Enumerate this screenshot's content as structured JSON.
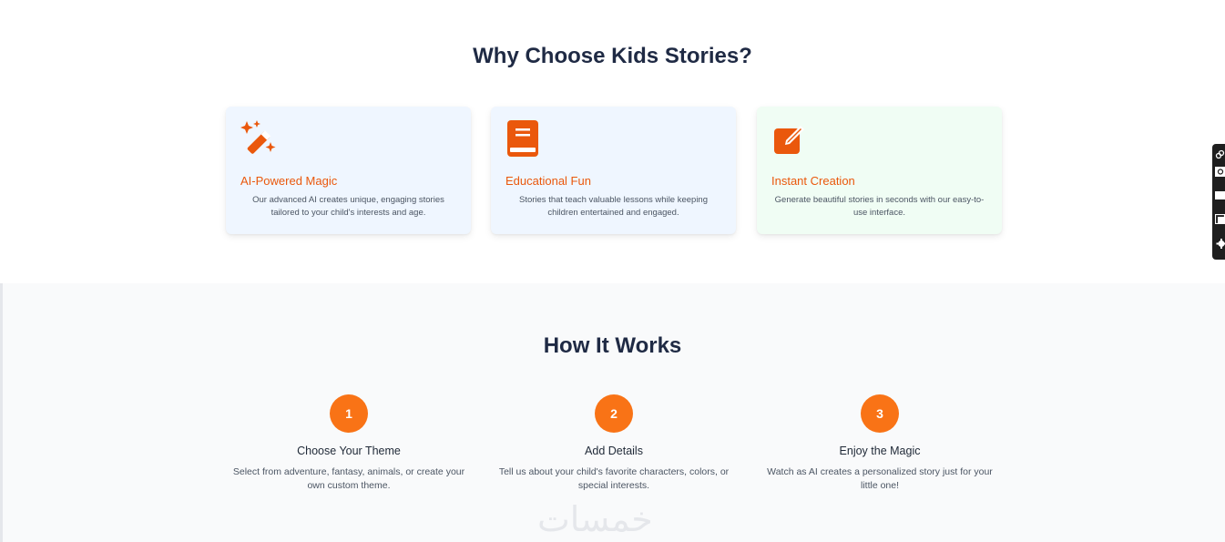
{
  "why": {
    "title": "Why Choose Kids Stories?",
    "cards": [
      {
        "icon": "magic-wand-icon",
        "title": "AI-Powered Magic",
        "description": "Our advanced AI creates unique, engaging stories tailored to your child's interests and age."
      },
      {
        "icon": "book-icon",
        "title": "Educational Fun",
        "description": "Stories that teach valuable lessons while keeping children entertained and engaged."
      },
      {
        "icon": "edit-icon",
        "title": "Instant Creation",
        "description": "Generate beautiful stories in seconds with our easy-to-use interface."
      }
    ]
  },
  "how": {
    "title": "How It Works",
    "steps": [
      {
        "number": "1",
        "title": "Choose Your Theme",
        "description": "Select from adventure, fantasy, animals, or create your own custom theme."
      },
      {
        "number": "2",
        "title": "Add Details",
        "description": "Tell us about your child's favorite characters, colors, or special interests."
      },
      {
        "number": "3",
        "title": "Enjoy the Magic",
        "description": "Watch as AI creates a personalized story just for your little one!"
      }
    ]
  },
  "watermark": "خمسات",
  "colors": {
    "accent": "#f97316",
    "icon": "#ea580c",
    "heading": "#1f2a44",
    "card_blue": "#eff6ff",
    "card_green": "#f0fdf4"
  }
}
